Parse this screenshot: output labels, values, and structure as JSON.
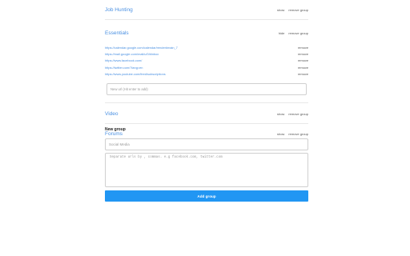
{
  "groups": [
    {
      "title": "Job Hunting",
      "toggle": "show",
      "remove": "remove group"
    },
    {
      "title": "Essentials",
      "toggle": "hide",
      "remove": "remove group",
      "links": [
        {
          "url": "https://calendar.google.com/calendar/render#main_7",
          "remove": "remove"
        },
        {
          "url": "https://mail.google.com/mail/u/0/#inbox",
          "remove": "remove"
        },
        {
          "url": "https://www.facebook.com/",
          "remove": "remove"
        },
        {
          "url": "https://twitter.com/?lang=en",
          "remove": "remove"
        },
        {
          "url": "https://www.youtube.com/feed/subscriptions",
          "remove": "remove"
        }
      ],
      "new_url_placeholder": "New url (Hit enter to add)"
    },
    {
      "title": "Video",
      "toggle": "show",
      "remove": "remove group"
    },
    {
      "title": "Forums",
      "toggle": "show",
      "remove": "remove group"
    }
  ],
  "new_group": {
    "label": "New group",
    "name_placeholder": "Social Media",
    "urls_placeholder": "Separate urls by , commas. e.g facebook.com, twitter.com",
    "add_button": "Add group"
  },
  "colors": {
    "link": "#4a90e2",
    "primary_button": "#2196f3"
  }
}
